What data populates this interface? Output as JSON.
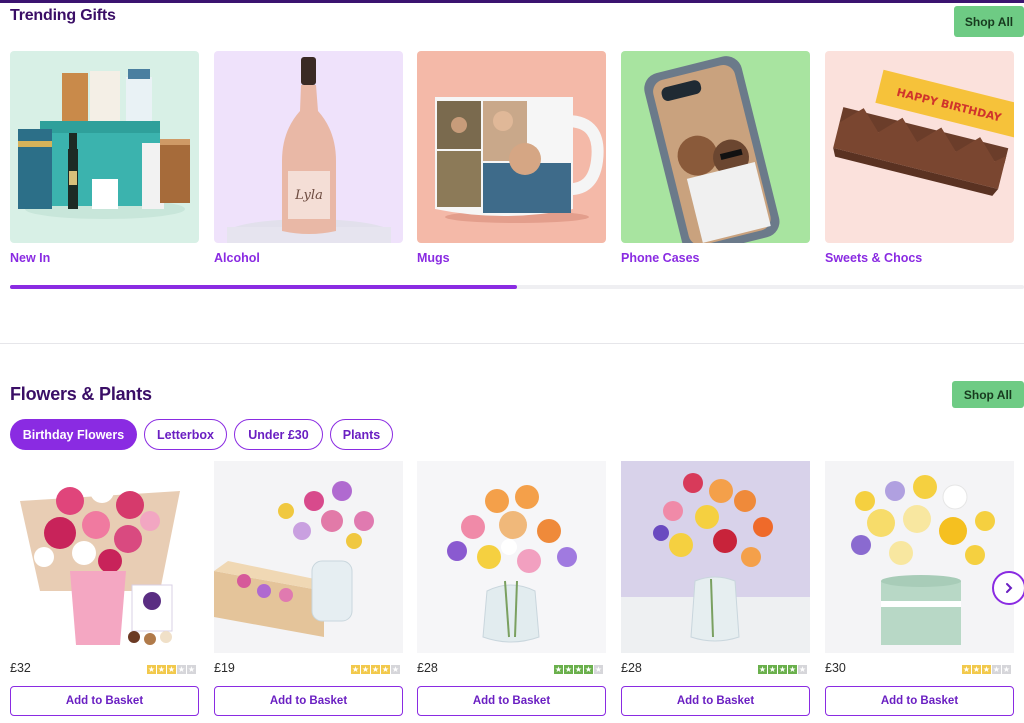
{
  "trending": {
    "title": "Trending Gifts",
    "shop_all": "Shop All",
    "categories": [
      {
        "label": "New In"
      },
      {
        "label": "Alcohol"
      },
      {
        "label": "Mugs"
      },
      {
        "label": "Phone Cases"
      },
      {
        "label": "Sweets & Chocs"
      }
    ],
    "scroll_progress": 0.5
  },
  "flowers": {
    "title": "Flowers & Plants",
    "shop_all": "Shop All",
    "filters": [
      {
        "label": "Birthday Flowers",
        "active": true
      },
      {
        "label": "Letterbox",
        "active": false
      },
      {
        "label": "Under £30",
        "active": false
      },
      {
        "label": "Plants",
        "active": false
      }
    ],
    "products": [
      {
        "price": "£32",
        "rating": 3,
        "rating_color": "#f2c94c",
        "button": "Add to Basket"
      },
      {
        "price": "£19",
        "rating": 4,
        "rating_color": "#f2c94c",
        "button": "Add to Basket"
      },
      {
        "price": "£28",
        "rating": 4,
        "rating_color": "#6ab04c",
        "button": "Add to Basket"
      },
      {
        "price": "£28",
        "rating": 4,
        "rating_color": "#6ab04c",
        "button": "Add to Basket"
      },
      {
        "price": "£30",
        "rating": 3,
        "rating_color": "#f2c94c",
        "button": "Add to Basket"
      }
    ],
    "next_icon": "chevron-right-icon"
  },
  "colors": {
    "accent": "#8a2be2",
    "shop_all_bg": "#6ecb84",
    "title": "#3a0e66"
  }
}
